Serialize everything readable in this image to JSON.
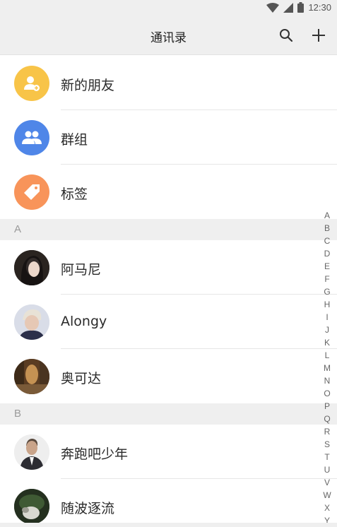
{
  "status_bar": {
    "time": "12:30"
  },
  "header": {
    "title": "通讯录"
  },
  "top_items": [
    {
      "label": "新的朋友",
      "icon": "add-friend-icon",
      "color": "#f8c448"
    },
    {
      "label": "群组",
      "icon": "group-icon",
      "color": "#4f86e8"
    },
    {
      "label": "标签",
      "icon": "tag-icon",
      "color": "#f8945a"
    }
  ],
  "sections": [
    {
      "letter": "A",
      "contacts": [
        "阿马尼",
        "Alongy",
        "奥可达"
      ]
    },
    {
      "letter": "B",
      "contacts": [
        "奔跑吧少年",
        "随波逐流"
      ]
    }
  ],
  "index_letters": [
    "A",
    "B",
    "C",
    "D",
    "E",
    "F",
    "G",
    "H",
    "I",
    "J",
    "K",
    "L",
    "M",
    "N",
    "O",
    "P",
    "Q",
    "R",
    "S",
    "T",
    "U",
    "V",
    "W",
    "X",
    "Y"
  ]
}
